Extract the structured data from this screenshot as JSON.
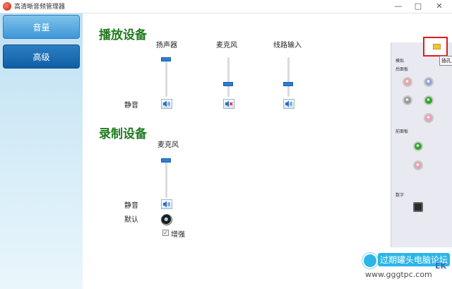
{
  "window": {
    "title": "高清晰音频管理器",
    "controls": {
      "minimize": "—",
      "maximize": "□",
      "close": "✕"
    }
  },
  "sidebar": {
    "items": [
      {
        "label": "音量",
        "active": true
      },
      {
        "label": "高级",
        "active": false
      }
    ]
  },
  "playback": {
    "title": "播放设备",
    "mute_label": "静音",
    "devices": [
      {
        "label": "扬声器",
        "level": 1.0,
        "muted": false
      },
      {
        "label": "麦克风",
        "level": 0.3,
        "muted": true
      },
      {
        "label": "线路输入",
        "level": 0.3,
        "muted": false
      }
    ]
  },
  "recording": {
    "title": "录制设备",
    "mute_label": "静音",
    "default_label": "默认",
    "boost_label": "增强",
    "boost_checked": true,
    "devices": [
      {
        "label": "麦克风",
        "level": 1.0,
        "muted": false
      }
    ]
  },
  "jack_panel": {
    "analog_label": "模拟",
    "rear_label": "后面板",
    "front_label": "前面板",
    "digital_label": "数字",
    "rear_jacks": [
      "#e6a6a0",
      "#8fa8d6",
      "#9a9a9a",
      "#2aa62a",
      "#e3a3b0"
    ],
    "front_jacks": [
      "#2aa62a",
      "#e3a3b0"
    ]
  },
  "tooltip": "插孔",
  "watermark": {
    "name": "过期罐头电脑论坛",
    "url": "www.gggtpc.com",
    "suffix": "EK"
  },
  "colors": {
    "section_title": "#1f7a1f",
    "slider_thumb": "#2a7fd4",
    "nav_active": "#3f96d6",
    "nav_idle": "#0f5ea6",
    "highlight_box": "#e01b1b"
  }
}
